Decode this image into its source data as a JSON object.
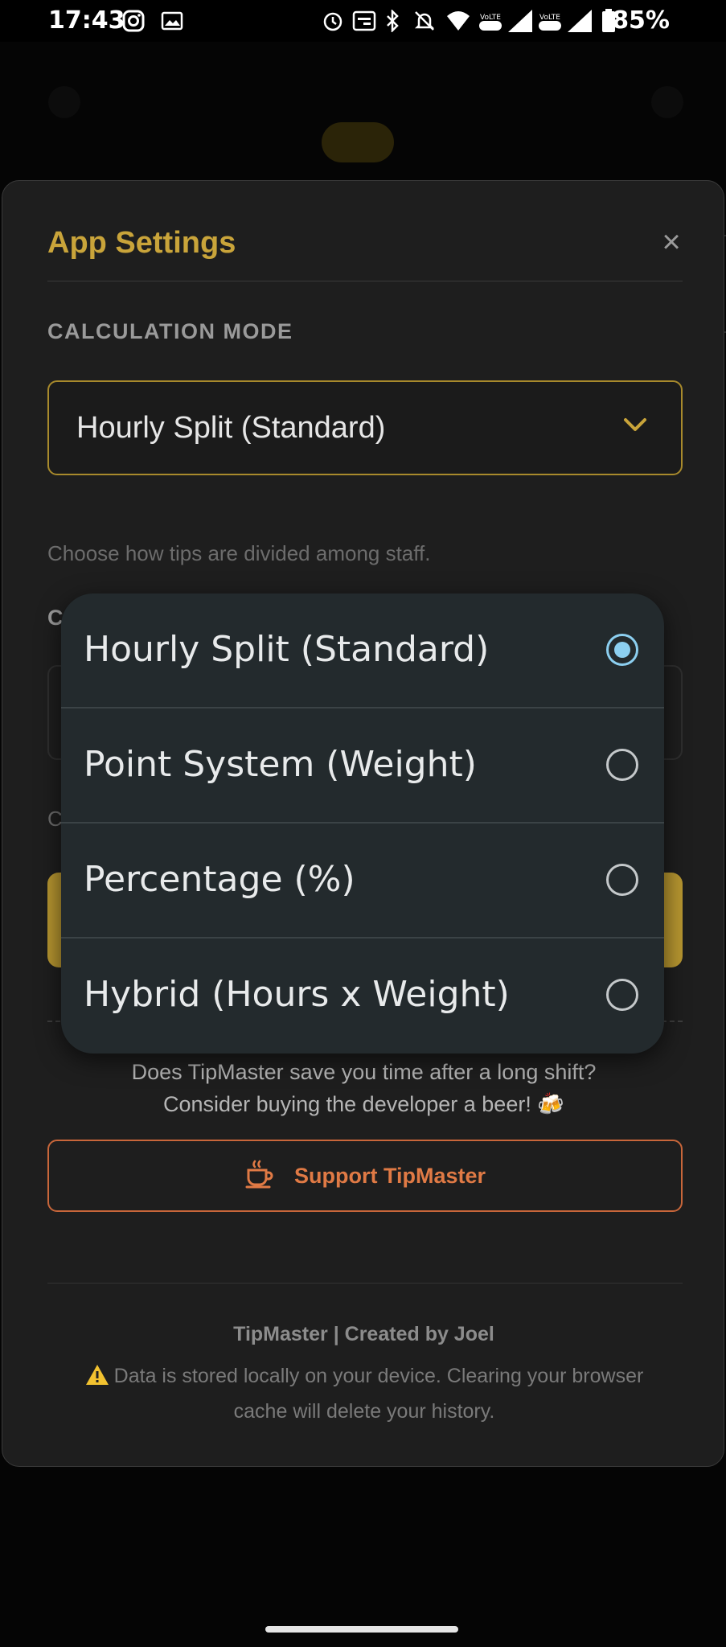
{
  "status_bar": {
    "time": "17:43",
    "battery": "85%",
    "icons": [
      "instagram-icon",
      "gallery-icon",
      "alarm-icon",
      "auto-hz-icon",
      "bluetooth-icon",
      "mute-icon",
      "wifi-icon",
      "volte-icon",
      "signal-icon",
      "volte-icon",
      "signal-icon",
      "battery-icon"
    ]
  },
  "modal": {
    "title": "App Settings",
    "close_glyph": "×",
    "section_label": "CALCULATION MODE",
    "selected_mode": "Hourly Split (Standard)",
    "helper_text": "Choose how tips are divided among staff.",
    "support_text_line1": "Does TipMaster save you time after a long shift?",
    "support_text_line2": "Consider buying the developer a beer! 🍻",
    "support_button_label": "Support TipMaster",
    "footer_credit": "TipMaster | Created by Joel",
    "footer_note": "Data is stored locally on your device. Clearing your browser cache will delete your history.",
    "accent_color": "#c9a43a",
    "support_color": "#e07a45"
  },
  "dropdown": {
    "options": [
      {
        "label": "Hourly Split (Standard)",
        "selected": true
      },
      {
        "label": "Point System (Weight)",
        "selected": false
      },
      {
        "label": "Percentage (%)",
        "selected": false
      },
      {
        "label": "Hybrid (Hours x Weight)",
        "selected": false
      }
    ],
    "radio_color": "#8ccff0"
  }
}
